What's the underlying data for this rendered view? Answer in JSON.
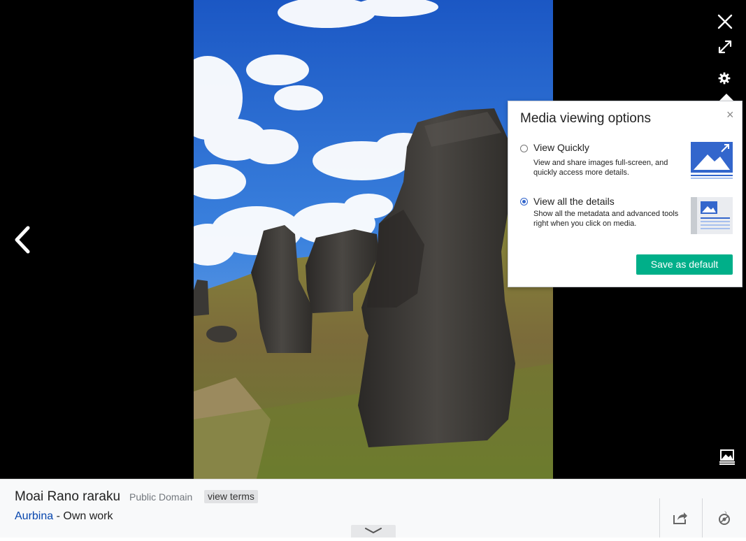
{
  "viewer": {
    "controls": {
      "close_icon": "close-icon",
      "fullscreen_icon": "fullscreen-icon",
      "options_icon": "gear-icon",
      "prev_icon": "chevron-left-icon",
      "gallery_icon": "gallery-icon"
    },
    "photo_alt": "Moai Rano raraku"
  },
  "options_popup": {
    "title": "Media viewing options",
    "close": "×",
    "options": [
      {
        "label": "View Quickly",
        "description": "View and share images full-screen, and quickly access more details.",
        "selected": false
      },
      {
        "label": "View all the details",
        "description": "Show all the metadata and advanced tools right when you click on media.",
        "selected": true
      }
    ],
    "save_label": "Save as default",
    "accent": "#00af89",
    "radio_color": "#3366cc"
  },
  "metadata": {
    "title": "Moai Rano raraku",
    "license": "Public Domain",
    "terms_label": "view terms",
    "author": "Aurbina",
    "credit_suffix": " - Own work",
    "link_color": "#0645ad",
    "share_icon": "share-icon",
    "reuse_icon": "reuse-icon",
    "expand_icon": "chevron-down-icon"
  }
}
